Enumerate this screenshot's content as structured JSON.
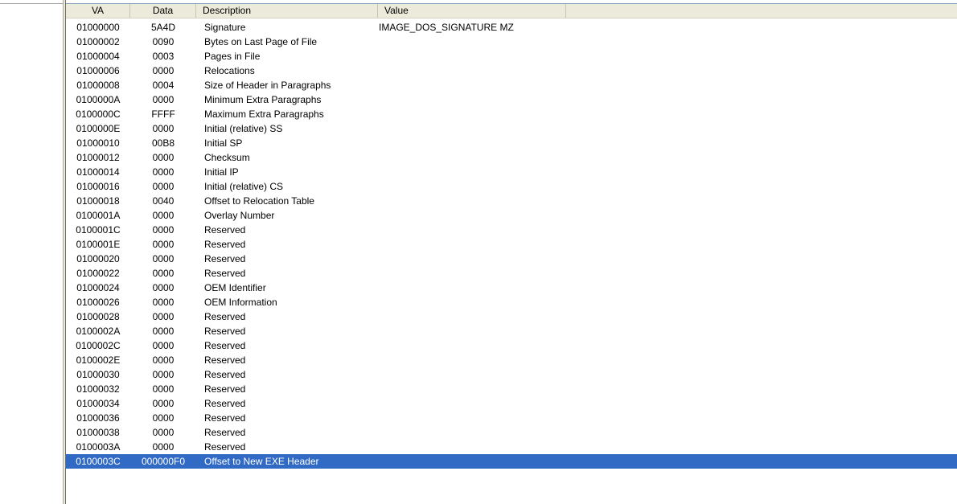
{
  "columns": {
    "va": "VA",
    "data": "Data",
    "description": "Description",
    "value": "Value"
  },
  "rows": [
    {
      "va": "01000000",
      "data": "5A4D",
      "description": "Signature",
      "value": "IMAGE_DOS_SIGNATURE  MZ"
    },
    {
      "va": "01000002",
      "data": "0090",
      "description": "Bytes on Last Page of File",
      "value": ""
    },
    {
      "va": "01000004",
      "data": "0003",
      "description": "Pages in File",
      "value": ""
    },
    {
      "va": "01000006",
      "data": "0000",
      "description": "Relocations",
      "value": ""
    },
    {
      "va": "01000008",
      "data": "0004",
      "description": "Size of Header in Paragraphs",
      "value": ""
    },
    {
      "va": "0100000A",
      "data": "0000",
      "description": "Minimum Extra Paragraphs",
      "value": ""
    },
    {
      "va": "0100000C",
      "data": "FFFF",
      "description": "Maximum Extra Paragraphs",
      "value": ""
    },
    {
      "va": "0100000E",
      "data": "0000",
      "description": "Initial (relative) SS",
      "value": ""
    },
    {
      "va": "01000010",
      "data": "00B8",
      "description": "Initial SP",
      "value": ""
    },
    {
      "va": "01000012",
      "data": "0000",
      "description": "Checksum",
      "value": ""
    },
    {
      "va": "01000014",
      "data": "0000",
      "description": "Initial IP",
      "value": ""
    },
    {
      "va": "01000016",
      "data": "0000",
      "description": "Initial (relative) CS",
      "value": ""
    },
    {
      "va": "01000018",
      "data": "0040",
      "description": "Offset to Relocation Table",
      "value": ""
    },
    {
      "va": "0100001A",
      "data": "0000",
      "description": "Overlay Number",
      "value": ""
    },
    {
      "va": "0100001C",
      "data": "0000",
      "description": "Reserved",
      "value": ""
    },
    {
      "va": "0100001E",
      "data": "0000",
      "description": "Reserved",
      "value": ""
    },
    {
      "va": "01000020",
      "data": "0000",
      "description": "Reserved",
      "value": ""
    },
    {
      "va": "01000022",
      "data": "0000",
      "description": "Reserved",
      "value": ""
    },
    {
      "va": "01000024",
      "data": "0000",
      "description": "OEM Identifier",
      "value": ""
    },
    {
      "va": "01000026",
      "data": "0000",
      "description": "OEM Information",
      "value": ""
    },
    {
      "va": "01000028",
      "data": "0000",
      "description": "Reserved",
      "value": ""
    },
    {
      "va": "0100002A",
      "data": "0000",
      "description": "Reserved",
      "value": ""
    },
    {
      "va": "0100002C",
      "data": "0000",
      "description": "Reserved",
      "value": ""
    },
    {
      "va": "0100002E",
      "data": "0000",
      "description": "Reserved",
      "value": ""
    },
    {
      "va": "01000030",
      "data": "0000",
      "description": "Reserved",
      "value": ""
    },
    {
      "va": "01000032",
      "data": "0000",
      "description": "Reserved",
      "value": ""
    },
    {
      "va": "01000034",
      "data": "0000",
      "description": "Reserved",
      "value": ""
    },
    {
      "va": "01000036",
      "data": "0000",
      "description": "Reserved",
      "value": ""
    },
    {
      "va": "01000038",
      "data": "0000",
      "description": "Reserved",
      "value": ""
    },
    {
      "va": "0100003A",
      "data": "0000",
      "description": "Reserved",
      "value": ""
    },
    {
      "va": "0100003C",
      "data": "000000F0",
      "description": "Offset to New EXE Header",
      "value": "",
      "selected": true
    }
  ],
  "colors": {
    "selection": "#316ac5",
    "header_bg": "#ebeadb"
  }
}
